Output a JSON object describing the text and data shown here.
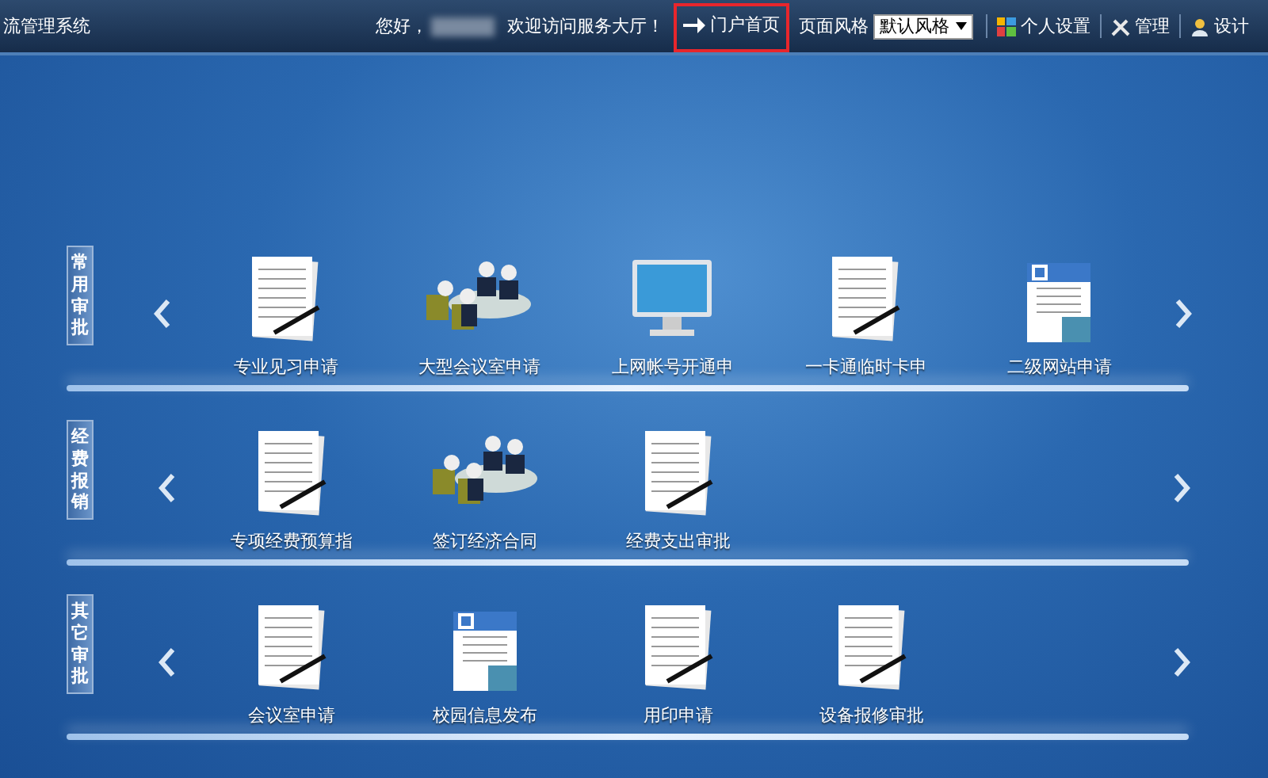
{
  "header": {
    "title": "流管理系统",
    "greeting": "您好，",
    "welcome": "欢迎访问服务大厅！",
    "portal_link": {
      "label": "门户首页",
      "highlighted": true
    },
    "style_label": "页面风格",
    "style_select": {
      "value": "默认风格"
    },
    "menu": [
      {
        "kind": "settings",
        "label": "个人设置"
      },
      {
        "kind": "manage",
        "label": "管理"
      },
      {
        "kind": "design",
        "label": "设计"
      }
    ]
  },
  "sections": [
    {
      "title": "常用审批",
      "items": [
        {
          "kind": "document",
          "label": "专业见习申请"
        },
        {
          "kind": "meeting",
          "label": "大型会议室申请"
        },
        {
          "kind": "monitor",
          "label": "上网帐号开通申"
        },
        {
          "kind": "document",
          "label": "一卡通临时卡申"
        },
        {
          "kind": "news",
          "label": "二级网站申请"
        }
      ]
    },
    {
      "title": "经费报销",
      "items": [
        {
          "kind": "document",
          "label": "专项经费预算指"
        },
        {
          "kind": "meeting",
          "label": "签订经济合同"
        },
        {
          "kind": "document",
          "label": "经费支出审批"
        }
      ]
    },
    {
      "title": "其它审批",
      "items": [
        {
          "kind": "document",
          "label": "会议室申请"
        },
        {
          "kind": "news",
          "label": "校园信息发布"
        },
        {
          "kind": "document",
          "label": "用印申请"
        },
        {
          "kind": "document",
          "label": "设备报修审批"
        }
      ]
    }
  ]
}
